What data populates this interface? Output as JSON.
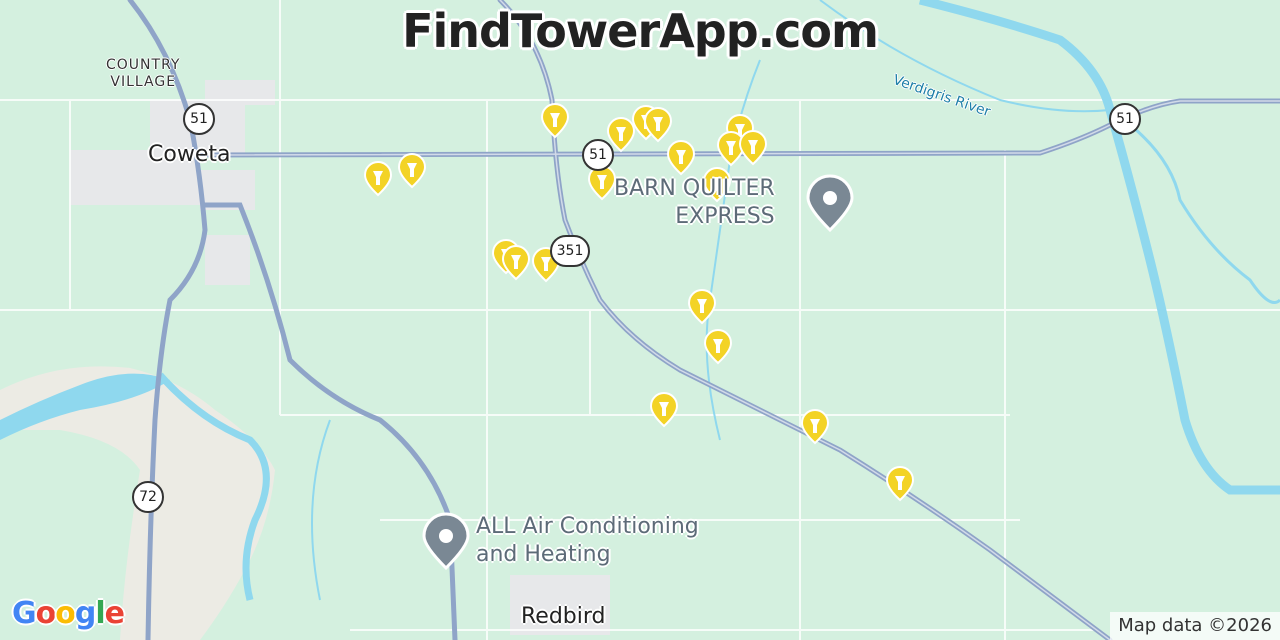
{
  "site_title": "FindTowerApp.com",
  "places": {
    "country_village": [
      "COUNTRY",
      "VILLAGE"
    ],
    "coweta": "Coweta",
    "redbird": "Redbird"
  },
  "river": "Verdigris River",
  "pois": {
    "barn": [
      "BARN QUILTER",
      "EXPRESS"
    ],
    "hvac": [
      "ALL Air Conditioning",
      "and Heating"
    ]
  },
  "route_shields": [
    {
      "label": "51"
    },
    {
      "label": "51"
    },
    {
      "label": "51"
    },
    {
      "label": "351"
    },
    {
      "label": "72"
    }
  ],
  "tower_markers_count": 21,
  "google_logo": {
    "letters": [
      "G",
      "o",
      "o",
      "g",
      "l",
      "e"
    ],
    "colors": [
      "#4285F4",
      "#EA4335",
      "#FBBC05",
      "#4285F4",
      "#34A853",
      "#EA4335"
    ]
  },
  "attribution": "Map data ©2026",
  "colors": {
    "land": "#d4f0df",
    "water": "#8fd8ee",
    "highway": "#8fa4c8",
    "tower_marker": "#f3d326",
    "poi_pin": "#7a8894"
  }
}
